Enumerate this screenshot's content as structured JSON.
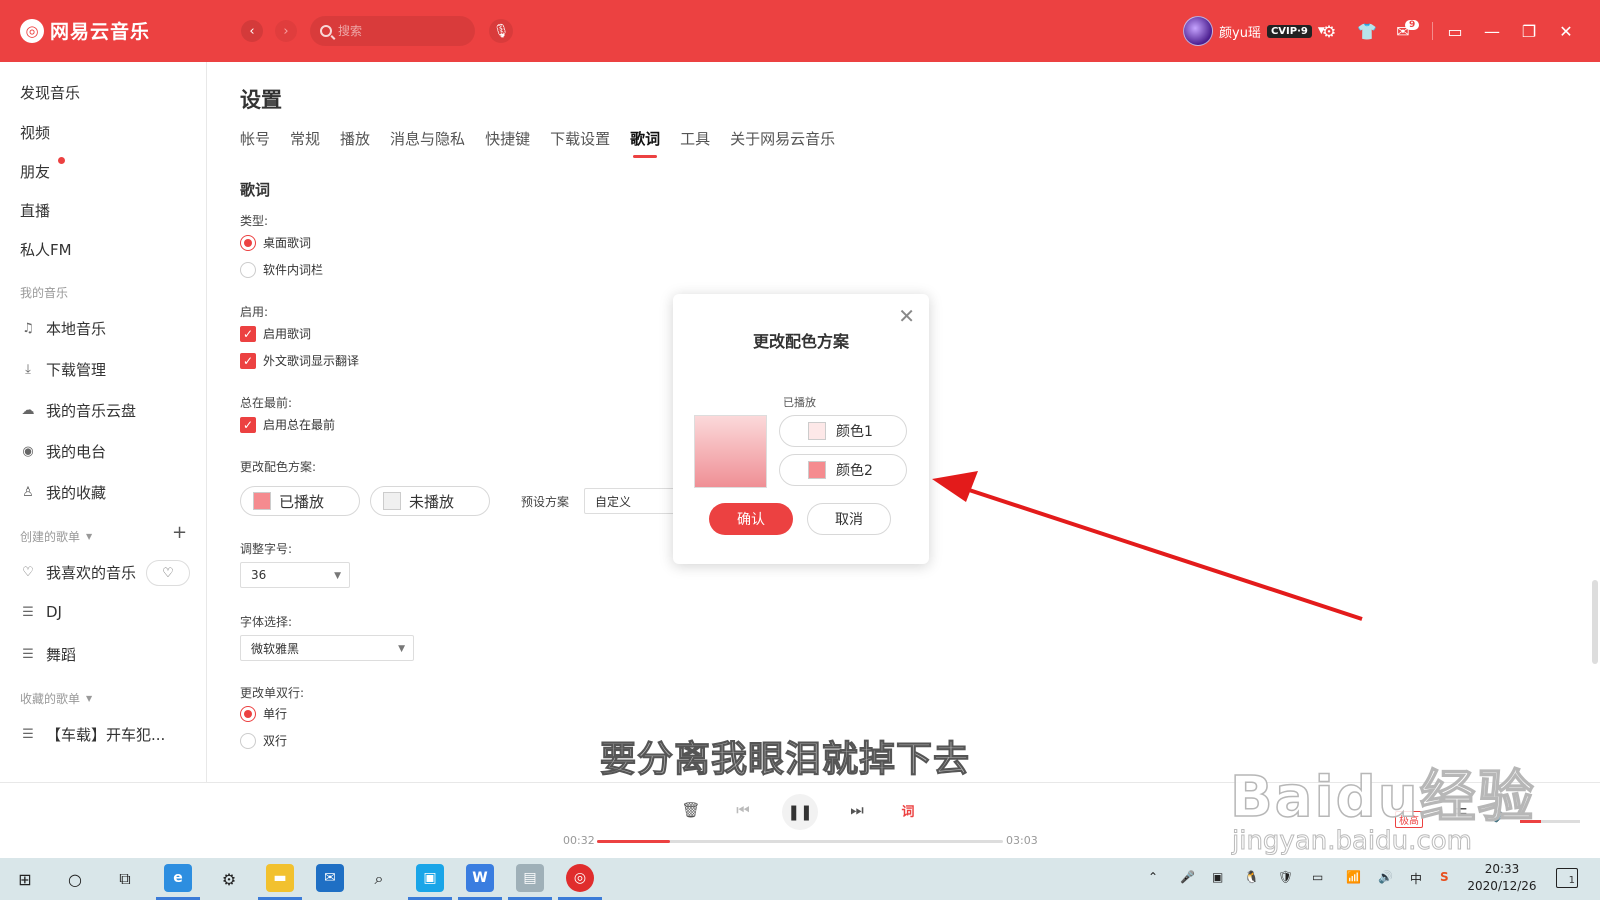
{
  "app": {
    "title": "网易云音乐"
  },
  "search": {
    "placeholder": "搜索"
  },
  "user": {
    "name": "颜yu瑶",
    "vip": "CVIP·9",
    "mail_count": "9"
  },
  "sidebar": {
    "main_items": [
      {
        "label": "发现音乐"
      },
      {
        "label": "视频"
      },
      {
        "label": "朋友"
      },
      {
        "label": "直播"
      },
      {
        "label": "私人FM"
      }
    ],
    "my_music_title": "我的音乐",
    "my_music": [
      {
        "label": "本地音乐",
        "icon": "music-note-icon"
      },
      {
        "label": "下载管理",
        "icon": "download-icon"
      },
      {
        "label": "我的音乐云盘",
        "icon": "cloud-icon"
      },
      {
        "label": "我的电台",
        "icon": "radio-icon"
      },
      {
        "label": "我的收藏",
        "icon": "user-collect-icon"
      }
    ],
    "created_title": "创建的歌单",
    "created": [
      {
        "label": "我喜欢的音乐",
        "icon": "heart-icon"
      },
      {
        "label": "DJ",
        "icon": "playlist-icon"
      },
      {
        "label": "舞蹈",
        "icon": "playlist-icon"
      }
    ],
    "collected_title": "收藏的歌单",
    "collected": [
      {
        "label": "【车载】开车犯...",
        "icon": "playlist-icon"
      }
    ]
  },
  "settings": {
    "title": "设置",
    "tabs": [
      "帐号",
      "常规",
      "播放",
      "消息与隐私",
      "快捷键",
      "下载设置",
      "歌词",
      "工具",
      "关于网易云音乐"
    ],
    "active_tab": "歌词",
    "section_title": "歌词",
    "type_label": "类型:",
    "type_options": [
      "桌面歌词",
      "软件内词栏"
    ],
    "enable_label": "启用:",
    "enable_options": [
      "启用歌词",
      "外文歌词显示翻译"
    ],
    "top_label": "总在最前:",
    "top_option": "启用总在最前",
    "color_label": "更改配色方案:",
    "played_label": "已播放",
    "unplayed_label": "未播放",
    "preset_label": "预设方案",
    "preset_value": "自定义",
    "font_size_label": "调整字号:",
    "font_size_value": "36",
    "font_label": "字体选择:",
    "font_value": "微软雅黑",
    "line_label": "更改单双行:",
    "line_options": [
      "单行",
      "双行"
    ]
  },
  "dialog": {
    "title": "更改配色方案",
    "played_caption": "已播放",
    "color1_label": "颜色1",
    "color2_label": "颜色2",
    "color1": "#fde8e8",
    "color2": "#f58b8f",
    "confirm_label": "确认",
    "cancel_label": "取消"
  },
  "lyric_overlay": "要分离我眼泪就掉下去",
  "player": {
    "current_time": "00:32",
    "total_time": "03:03",
    "progress": 0.18,
    "lyric_button": "词",
    "quality": "极高",
    "volume": 0.35
  },
  "taskbar": {
    "time": "20:33",
    "date": "2020/12/26",
    "ime": "中",
    "notification_count": "1"
  },
  "watermark": {
    "brand": "Baidu经验",
    "url": "jingyan.baidu.com"
  },
  "colors": {
    "accent": "#ec4141",
    "taskbar": "#d9e6e9"
  }
}
